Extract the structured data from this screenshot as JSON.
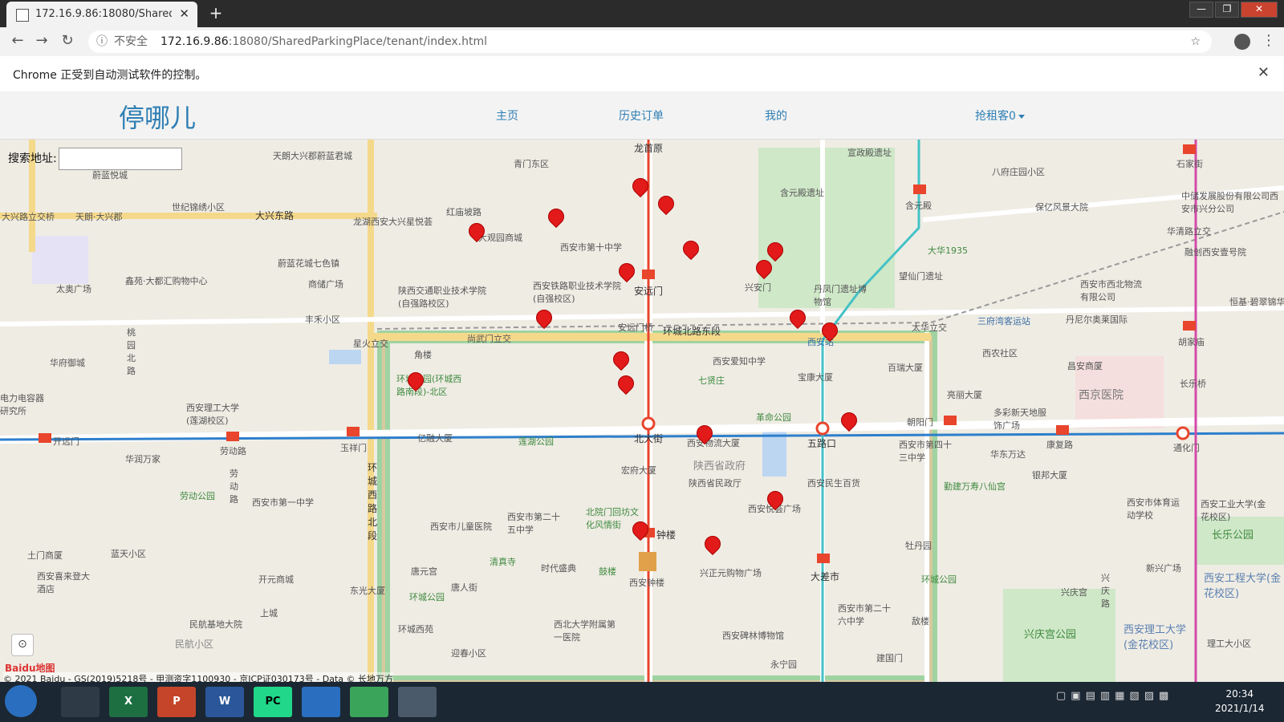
{
  "browser": {
    "tab_title": "172.16.9.86:18080/SharedPark",
    "tab_close": "✕",
    "new_tab": "+",
    "win_min": "—",
    "win_max": "❐",
    "win_close": "✕",
    "back": "←",
    "forward": "→",
    "reload": "↻",
    "info_icon": "ⓘ",
    "security": "不安全",
    "url_host": "172.16.9.86",
    "url_rest": ":18080/SharedParkingPlace/tenant/index.html",
    "star": "☆",
    "menu": "⋮"
  },
  "infobar": {
    "text": "Chrome 正受到自动测试软件的控制。",
    "close": "✕"
  },
  "nav": {
    "brand": "停哪儿",
    "home": "主页",
    "history": "历史订单",
    "mine": "我的",
    "rent": "抢租客0"
  },
  "search": {
    "label": "搜索地址:",
    "value": ""
  },
  "map": {
    "labels": {
      "l1": "天朗大兴郡蔚蓝君城",
      "l2": "蔚蓝悦城",
      "l3": "青门东区",
      "l4": "龙首原",
      "l5": "宣政殿遗址",
      "l6": "八府庄园小区",
      "l7": "石家街",
      "l8": "世纪锦绣小区",
      "l9": "大兴路立交桥",
      "l10": "天朗·大兴郡",
      "l11": "大兴东路",
      "l12": "龙湖西安大兴星悦荟",
      "l13": "红庙坡路",
      "l14": "大观园商城",
      "l15": "西安市第十中学",
      "l16": "含元殿遗址",
      "l17": "含元殿",
      "l18": "保亿风景大院",
      "l19": "中储发展股份有限公司西安市兴分公司",
      "l20": "华清路立交",
      "l21": "太奥广场",
      "l22": "鑫苑·大都汇购物中心",
      "l23": "蔚蓝花城七色镇",
      "l24": "商储广场",
      "l25": "陕西交通职业技术学院(自强路校区)",
      "l26": "西安铁路职业技术学院(自强校区)",
      "l27": "安远门",
      "l28": "兴安门",
      "l29": "丹凤门遗址博物馆",
      "l30": "望仙门遗址",
      "l31": "大华1935",
      "l32": "融创西安壹号院",
      "l33": "西安市西北物流有限公司",
      "l34": "恒基·碧翠锦华",
      "l35": "丰禾小区",
      "l36": "桃园北路",
      "l37": "华府御城",
      "l38": "星火立交",
      "l39": "尚武门立交",
      "l40": "安远门桥",
      "l41": "环城北路东段",
      "l42": "西安站",
      "l43": "太华立交",
      "l44": "三府湾客运站",
      "l45": "丹尼尔奥莱国际",
      "l46": "胡家庙",
      "l47": "角楼",
      "l48": "西安爱知中学",
      "l49": "七贤庄",
      "l50": "宝康大厦",
      "l51": "百瑞大厦",
      "l52": "西农社区",
      "l53": "昌安商厦",
      "l54": "长乐桥",
      "l55": "环城公园(环城西路南段)-北区",
      "l56": "西安理工大学(莲湖校区)",
      "l57": "电力电容器研究所",
      "l58": "革命公园",
      "l59": "亮丽大厦",
      "l60": "多彩新天地服饰广场",
      "l61": "西京医院",
      "l62": "开远门",
      "l63": "劳动路",
      "l64": "玉祥门",
      "l65": "亿融大厦",
      "l66": "莲湖公园",
      "l67": "北大街",
      "l68": "西安物流大厦",
      "l69": "五路口",
      "l70": "朝阳门",
      "l71": "西安市第四十三中学",
      "l72": "华东万达",
      "l73": "康复路",
      "l74": "通化门",
      "l75": "华润万家",
      "l76": "劳动公园",
      "l77": "劳动路",
      "l78": "环城西路北段",
      "l79": "宏府大厦",
      "l80": "陕西省政府",
      "l81": "陕西省民政厅",
      "l82": "西安民生百货",
      "l83": "银邦大厦",
      "l84": "勤建万寿八仙宫",
      "l85": "西安市体育运动学校",
      "l86": "西安工业大学(金花校区)",
      "l87": "西安市第一中学",
      "l88": "西安市儿童医院",
      "l89": "西安市第二十五中学",
      "l90": "北院门回坊文化风情街",
      "l91": "钟楼",
      "l92": "西安悦荟广场",
      "l93": "长乐公园",
      "l94": "土门商厦",
      "l95": "蓝天小区",
      "l96": "清真寺",
      "l97": "时代盛典",
      "l98": "鼓楼",
      "l99": "西安钟楼",
      "l100": "兴正元购物广场",
      "l101": "大差市",
      "l102": "牡丹园",
      "l103": "环城公园",
      "l104": "新兴广场",
      "l105": "西安工程大学(金花校区)",
      "l106": "西安喜来登大酒店",
      "l107": "开元商城",
      "l108": "东光大厦",
      "l109": "唐元宫",
      "l110": "唐人街",
      "l111": "环城公园",
      "l112": "西安市第二十六中学",
      "l113": "兴庆宫",
      "l114": "兴庆路",
      "l115": "上城",
      "l116": "民航基地大院",
      "l117": "西北大学附属第一医院",
      "l118": "环城西苑",
      "l119": "西安碑林博物馆",
      "l120": "敌楼",
      "l121": "兴庆宫公园",
      "l122": "西安理工大学(金花校区)",
      "l123": "理工大小区",
      "l124": "民航小区",
      "l125": "迎春小区",
      "l126": "永宁园",
      "l127": "建国门",
      "l128": "电力电容器研究所",
      "l129": "西京医院"
    },
    "logo": "Baidu地图",
    "copyright": "© 2021 Baidu - GS(2019)5218号 - 甲测资字1100930 - 京ICP证030173号 - Data © 长地万方",
    "locate": "⊙"
  },
  "taskbar": {
    "excel": "X",
    "ppt": "P",
    "word": "W",
    "pycharm": "PC",
    "time": "20:34",
    "date": "2021/1/14"
  }
}
